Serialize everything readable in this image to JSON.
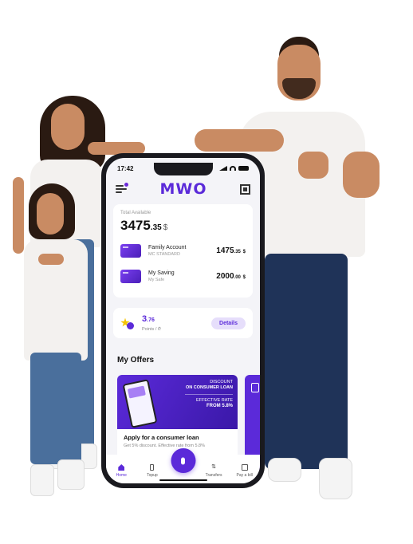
{
  "status_bar": {
    "time": "17:42"
  },
  "header": {
    "logo": "MWO"
  },
  "balance": {
    "label": "Total Available",
    "whole": "3475",
    "decimal": ".35",
    "currency": "$"
  },
  "accounts": [
    {
      "name": "Family Account",
      "sub": "MC STANDARD",
      "amount_whole": "1475",
      "amount_decimal": ".35",
      "currency": "$"
    },
    {
      "name": "My Saving",
      "sub": "My Safe",
      "amount_whole": "2000",
      "amount_decimal": ".00",
      "currency": "$"
    }
  ],
  "points": {
    "whole": "3",
    "decimal": ".76",
    "label": "Points / ₾",
    "details_label": "Details"
  },
  "offers": {
    "title": "My Offers",
    "card": {
      "discount_line1": "DISCOUNT",
      "discount_line2": "ON CONSUMER LOAN",
      "rate_line1": "EFFECTIVE RATE",
      "rate_line2": "FROM 5.8%",
      "title": "Apply for a consumer loan",
      "desc": "Get 5% discount. Effective rate from 5.8%"
    }
  },
  "bottom_nav": {
    "items": [
      {
        "label": "Home"
      },
      {
        "label": "Topup"
      },
      {
        "label": "Transfers"
      },
      {
        "label": "Pay a bill"
      }
    ]
  },
  "colors": {
    "brand": "#5b2ad9",
    "brand_light": "#e6defb",
    "star": "#f5c400"
  }
}
